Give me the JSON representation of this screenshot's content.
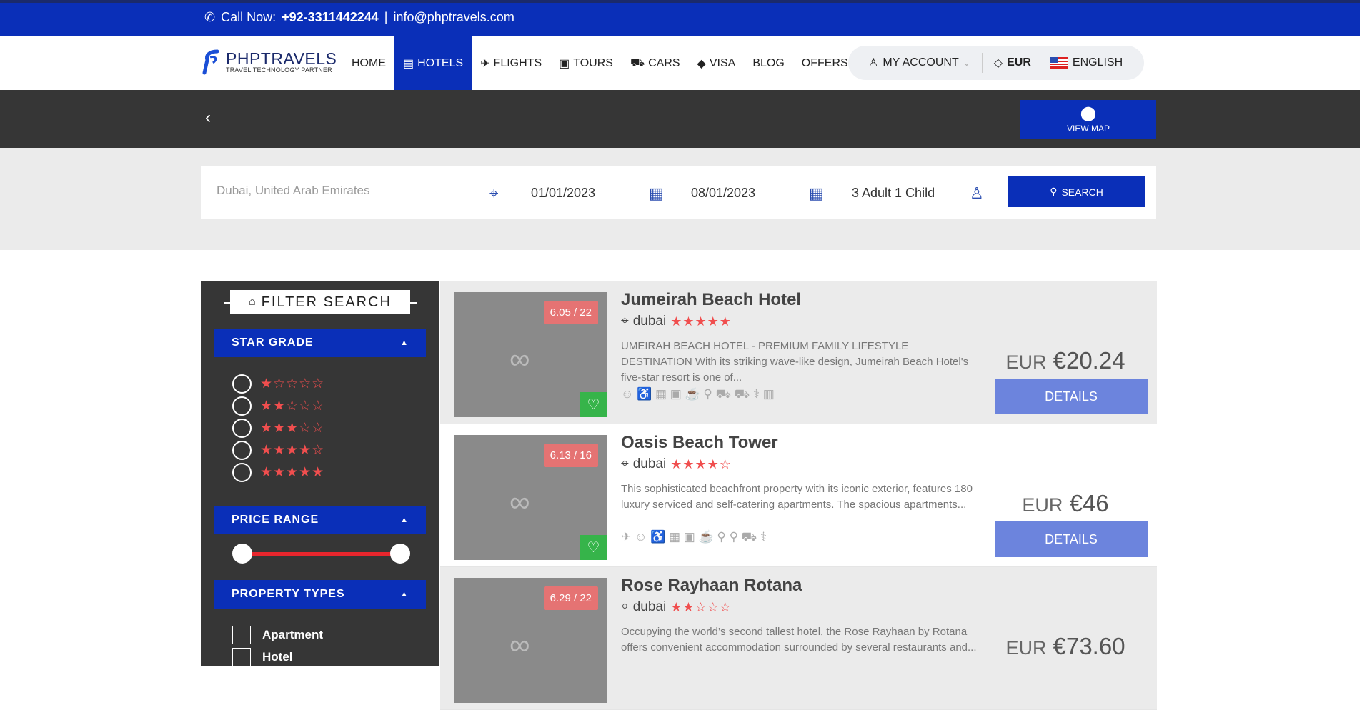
{
  "topbar": {
    "call_label": "Call Now:",
    "phone": "+92-3311442244",
    "sep": "|",
    "email": "info@phptravels.com"
  },
  "logo": {
    "brand": "PHPTRAVELS",
    "tagline": "TRAVEL TECHNOLOGY PARTNER"
  },
  "menu": [
    {
      "label": "HOME"
    },
    {
      "label": "HOTELS",
      "icon": "building-icon",
      "active": true
    },
    {
      "label": "FLIGHTS",
      "icon": "plane-icon"
    },
    {
      "label": "TOURS",
      "icon": "suitcase-icon"
    },
    {
      "label": "CARS",
      "icon": "car-icon"
    },
    {
      "label": "VISA",
      "icon": "tag-icon"
    },
    {
      "label": "BLOG"
    },
    {
      "label": "OFFERS"
    }
  ],
  "account": {
    "my_account": "MY ACCOUNT",
    "currency": "EUR",
    "language": "ENGLISH"
  },
  "header": {
    "view_map": "VIEW MAP"
  },
  "search": {
    "location_placeholder": "Dubai, United Arab Emirates",
    "checkin": "01/01/2023",
    "checkout": "08/01/2023",
    "guests": "3 Adult 1 Child",
    "button": "SEARCH"
  },
  "filters": {
    "title": "FILTER SEARCH",
    "star_grade": "STAR GRADE",
    "star_options": [
      "★☆☆☆☆",
      "★★☆☆☆",
      "★★★☆☆",
      "★★★★☆",
      "★★★★★"
    ],
    "price_range": "PRICE RANGE",
    "property_types": "PROPERTY TYPES",
    "types": [
      "Apartment",
      "Hotel"
    ]
  },
  "hotels": [
    {
      "name": "Jumeirah Beach Hotel",
      "location": "dubai",
      "stars": "★★★★★",
      "rating": "6.05 / 22",
      "description": "UMEIRAH BEACH HOTEL - PREMIUM FAMILY LIFESTYLE DESTINATION With its striking wave-like design, Jumeirah Beach Hotel's five-star resort is one of...",
      "currency": "EUR",
      "price": "€20.24",
      "button": "DETAILS",
      "amenities": "☺ ♿ ▦ ▣ ☕ ⚲ ⛟ ⛟ ⚕ ▥"
    },
    {
      "name": "Oasis Beach Tower",
      "location": "dubai",
      "stars": "★★★★☆",
      "rating": "6.13 / 16",
      "description": "This sophisticated beachfront property with its iconic exterior, features 180 luxury serviced and self-catering apartments. The spacious apartments...",
      "currency": "EUR",
      "price": "€46",
      "button": "DETAILS",
      "amenities": "✈ ☺ ♿ ▦ ▣ ☕ ⚲ ⚲ ⛟ ⚕"
    },
    {
      "name": "Rose Rayhaan Rotana",
      "location": "dubai",
      "stars": "★★☆☆☆",
      "rating": "6.29 / 22",
      "description": "Occupying the world’s second tallest hotel, the Rose Rayhaan by Rotana offers convenient accommodation surrounded by several restaurants and...",
      "currency": "EUR",
      "price": "€73.60",
      "button": "DETAILS",
      "amenities": ""
    }
  ]
}
